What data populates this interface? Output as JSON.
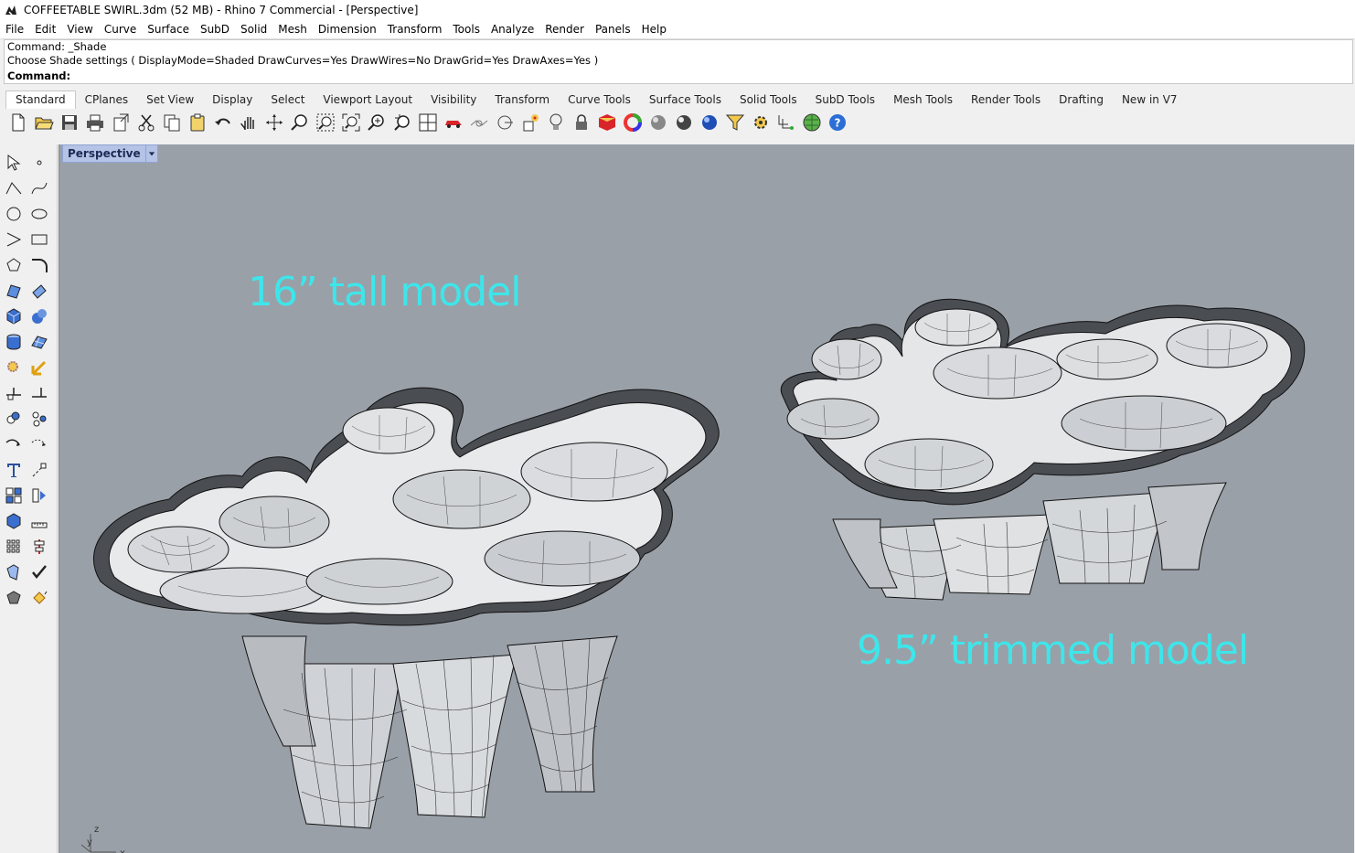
{
  "window": {
    "title": "COFFEETABLE SWIRL.3dm (52 MB) - Rhino 7 Commercial - [Perspective]"
  },
  "menu": [
    "File",
    "Edit",
    "View",
    "Curve",
    "Surface",
    "SubD",
    "Solid",
    "Mesh",
    "Dimension",
    "Transform",
    "Tools",
    "Analyze",
    "Render",
    "Panels",
    "Help"
  ],
  "command": {
    "history": [
      "Command: _Shade",
      "Choose Shade settings ( DisplayMode=Shaded  DrawCurves=Yes  DrawWires=No  DrawGrid=Yes  DrawAxes=Yes )"
    ],
    "prompt": "Command:"
  },
  "toolbar_tabs": [
    "Standard",
    "CPlanes",
    "Set View",
    "Display",
    "Select",
    "Viewport Layout",
    "Visibility",
    "Transform",
    "Curve Tools",
    "Surface Tools",
    "Solid Tools",
    "SubD Tools",
    "Mesh Tools",
    "Render Tools",
    "Drafting",
    "New in V7"
  ],
  "active_tab": "Standard",
  "toolbar_icons": [
    "new-file-icon",
    "open-folder-icon",
    "save-icon",
    "print-icon",
    "import-icon",
    "cut-icon",
    "copy-icon",
    "paste-icon",
    "undo-icon",
    "pan-hand-icon",
    "rotate-view-icon",
    "zoom-icon",
    "zoom-window-icon",
    "zoom-extents-icon",
    "zoom-selected-icon",
    "undo-view-icon",
    "four-viewports-icon",
    "car-icon",
    "wire-icon",
    "cplane-icon",
    "gumball-icon",
    "light-bulb-icon",
    "lock-icon",
    "object-color-icon",
    "color-wheel-icon",
    "shade-sphere-icon",
    "render-sphere-icon",
    "blue-sphere-icon",
    "filter-icon",
    "settings-gear-icon",
    "grid-snap-icon",
    "globe-icon",
    "help-icon"
  ],
  "viewport": {
    "name": "Perspective",
    "annotations": {
      "tall": "16” tall model",
      "trimmed": "9.5” trimmed model"
    },
    "axes": {
      "x": "x",
      "y": "y",
      "z": "z"
    }
  },
  "colors": {
    "viewport_bg": "#9aa0a8",
    "annotation": "#3de6ea",
    "viewport_tab": "#b4c3e6"
  }
}
